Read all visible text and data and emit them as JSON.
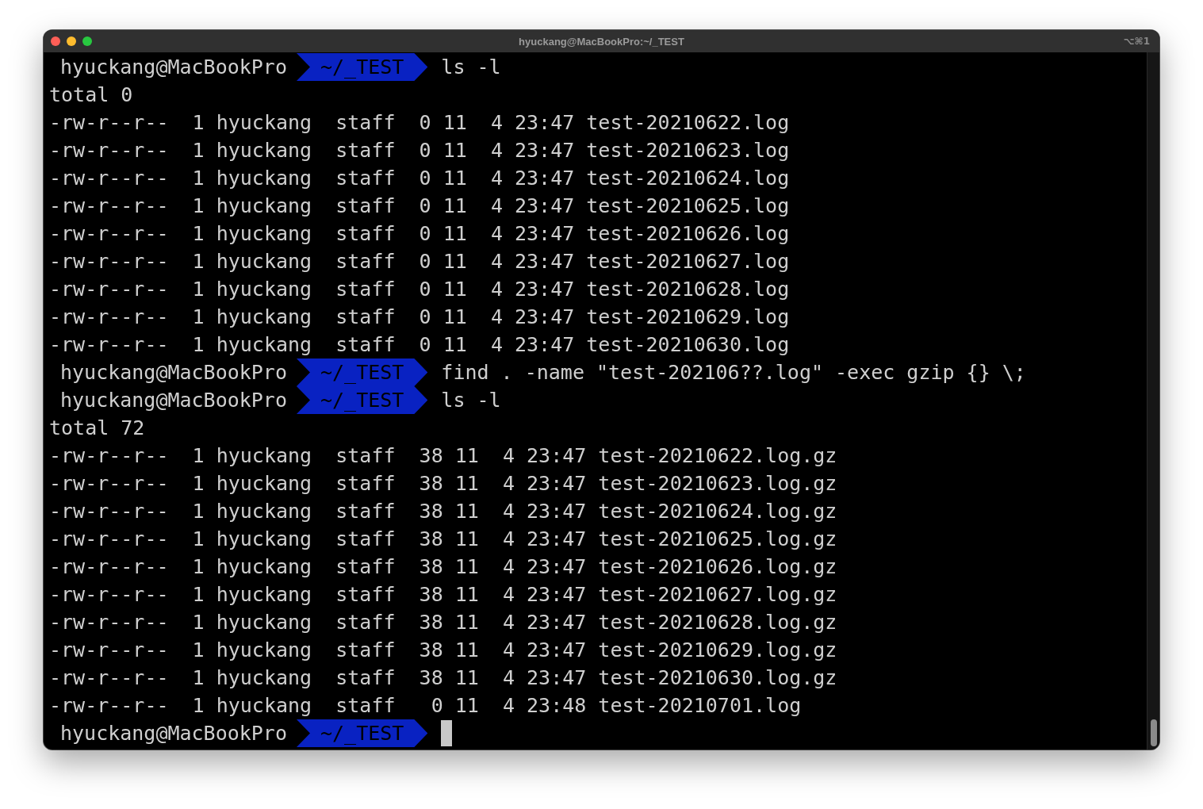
{
  "window": {
    "title": "hyuckang@MacBookPro:~/_TEST",
    "shortcut": "⌥⌘1"
  },
  "lines": [
    {
      "kind": "prompt",
      "user": "hyuckang@MacBookPro",
      "path": "~/_TEST",
      "command": "ls -l"
    },
    {
      "kind": "output",
      "text": "total 0"
    },
    {
      "kind": "output",
      "text": "-rw-r--r--  1 hyuckang  staff  0 11  4 23:47 test-20210622.log"
    },
    {
      "kind": "output",
      "text": "-rw-r--r--  1 hyuckang  staff  0 11  4 23:47 test-20210623.log"
    },
    {
      "kind": "output",
      "text": "-rw-r--r--  1 hyuckang  staff  0 11  4 23:47 test-20210624.log"
    },
    {
      "kind": "output",
      "text": "-rw-r--r--  1 hyuckang  staff  0 11  4 23:47 test-20210625.log"
    },
    {
      "kind": "output",
      "text": "-rw-r--r--  1 hyuckang  staff  0 11  4 23:47 test-20210626.log"
    },
    {
      "kind": "output",
      "text": "-rw-r--r--  1 hyuckang  staff  0 11  4 23:47 test-20210627.log"
    },
    {
      "kind": "output",
      "text": "-rw-r--r--  1 hyuckang  staff  0 11  4 23:47 test-20210628.log"
    },
    {
      "kind": "output",
      "text": "-rw-r--r--  1 hyuckang  staff  0 11  4 23:47 test-20210629.log"
    },
    {
      "kind": "output",
      "text": "-rw-r--r--  1 hyuckang  staff  0 11  4 23:47 test-20210630.log"
    },
    {
      "kind": "prompt",
      "user": "hyuckang@MacBookPro",
      "path": "~/_TEST",
      "command": "find . -name \"test-202106??.log\" -exec gzip {} \\;"
    },
    {
      "kind": "prompt",
      "user": "hyuckang@MacBookPro",
      "path": "~/_TEST",
      "command": "ls -l"
    },
    {
      "kind": "output",
      "text": "total 72"
    },
    {
      "kind": "output",
      "text": "-rw-r--r--  1 hyuckang  staff  38 11  4 23:47 test-20210622.log.gz"
    },
    {
      "kind": "output",
      "text": "-rw-r--r--  1 hyuckang  staff  38 11  4 23:47 test-20210623.log.gz"
    },
    {
      "kind": "output",
      "text": "-rw-r--r--  1 hyuckang  staff  38 11  4 23:47 test-20210624.log.gz"
    },
    {
      "kind": "output",
      "text": "-rw-r--r--  1 hyuckang  staff  38 11  4 23:47 test-20210625.log.gz"
    },
    {
      "kind": "output",
      "text": "-rw-r--r--  1 hyuckang  staff  38 11  4 23:47 test-20210626.log.gz"
    },
    {
      "kind": "output",
      "text": "-rw-r--r--  1 hyuckang  staff  38 11  4 23:47 test-20210627.log.gz"
    },
    {
      "kind": "output",
      "text": "-rw-r--r--  1 hyuckang  staff  38 11  4 23:47 test-20210628.log.gz"
    },
    {
      "kind": "output",
      "text": "-rw-r--r--  1 hyuckang  staff  38 11  4 23:47 test-20210629.log.gz"
    },
    {
      "kind": "output",
      "text": "-rw-r--r--  1 hyuckang  staff  38 11  4 23:47 test-20210630.log.gz"
    },
    {
      "kind": "output",
      "text": "-rw-r--r--  1 hyuckang  staff   0 11  4 23:48 test-20210701.log"
    },
    {
      "kind": "prompt",
      "user": "hyuckang@MacBookPro",
      "path": "~/_TEST",
      "cursor": true
    }
  ]
}
